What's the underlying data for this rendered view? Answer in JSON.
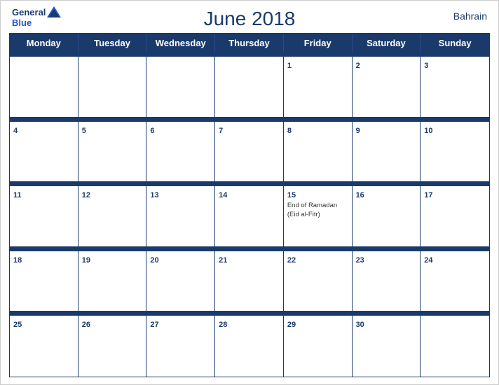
{
  "header": {
    "title": "June 2018",
    "country": "Bahrain",
    "logo": {
      "line1": "General",
      "line2": "Blue"
    }
  },
  "dayHeaders": [
    "Monday",
    "Tuesday",
    "Wednesday",
    "Thursday",
    "Friday",
    "Saturday",
    "Sunday"
  ],
  "weeks": [
    [
      {
        "day": "",
        "event": ""
      },
      {
        "day": "",
        "event": ""
      },
      {
        "day": "",
        "event": ""
      },
      {
        "day": "",
        "event": ""
      },
      {
        "day": "1",
        "event": ""
      },
      {
        "day": "2",
        "event": ""
      },
      {
        "day": "3",
        "event": ""
      }
    ],
    [
      {
        "day": "4",
        "event": ""
      },
      {
        "day": "5",
        "event": ""
      },
      {
        "day": "6",
        "event": ""
      },
      {
        "day": "7",
        "event": ""
      },
      {
        "day": "8",
        "event": ""
      },
      {
        "day": "9",
        "event": ""
      },
      {
        "day": "10",
        "event": ""
      }
    ],
    [
      {
        "day": "11",
        "event": ""
      },
      {
        "day": "12",
        "event": ""
      },
      {
        "day": "13",
        "event": ""
      },
      {
        "day": "14",
        "event": ""
      },
      {
        "day": "15",
        "event": "End of Ramadan (Eid al-Fitr)"
      },
      {
        "day": "16",
        "event": ""
      },
      {
        "day": "17",
        "event": ""
      }
    ],
    [
      {
        "day": "18",
        "event": ""
      },
      {
        "day": "19",
        "event": ""
      },
      {
        "day": "20",
        "event": ""
      },
      {
        "day": "21",
        "event": ""
      },
      {
        "day": "22",
        "event": ""
      },
      {
        "day": "23",
        "event": ""
      },
      {
        "day": "24",
        "event": ""
      }
    ],
    [
      {
        "day": "25",
        "event": ""
      },
      {
        "day": "26",
        "event": ""
      },
      {
        "day": "27",
        "event": ""
      },
      {
        "day": "28",
        "event": ""
      },
      {
        "day": "29",
        "event": ""
      },
      {
        "day": "30",
        "event": ""
      },
      {
        "day": "",
        "event": ""
      }
    ]
  ],
  "colors": {
    "headerBg": "#1a3a6b",
    "headerText": "#ffffff",
    "titleColor": "#1a3a6b",
    "accent": "#2255cc"
  }
}
